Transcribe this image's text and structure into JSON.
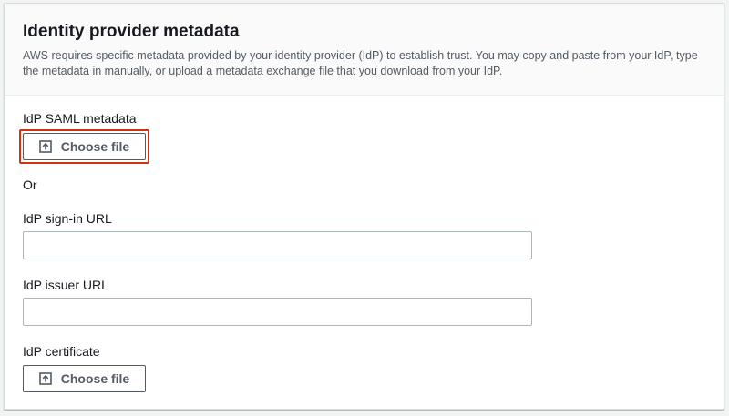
{
  "header": {
    "title": "Identity provider metadata",
    "description": "AWS requires specific metadata provided by your identity provider (IdP) to establish trust. You may copy and paste from your IdP, type the metadata in manually, or upload a metadata exchange file that you download from your IdP."
  },
  "saml_metadata": {
    "label": "IdP SAML metadata",
    "button_label": "Choose file",
    "icon": "upload-icon"
  },
  "or_text": "Or",
  "sign_in_url": {
    "label": "IdP sign-in URL",
    "value": "",
    "placeholder": ""
  },
  "issuer_url": {
    "label": "IdP issuer URL",
    "value": "",
    "placeholder": ""
  },
  "certificate": {
    "label": "IdP certificate",
    "button_label": "Choose file",
    "icon": "upload-icon"
  },
  "colors": {
    "highlight": "#d13212",
    "button_text": "#545b64",
    "border": "#aab7b8"
  }
}
